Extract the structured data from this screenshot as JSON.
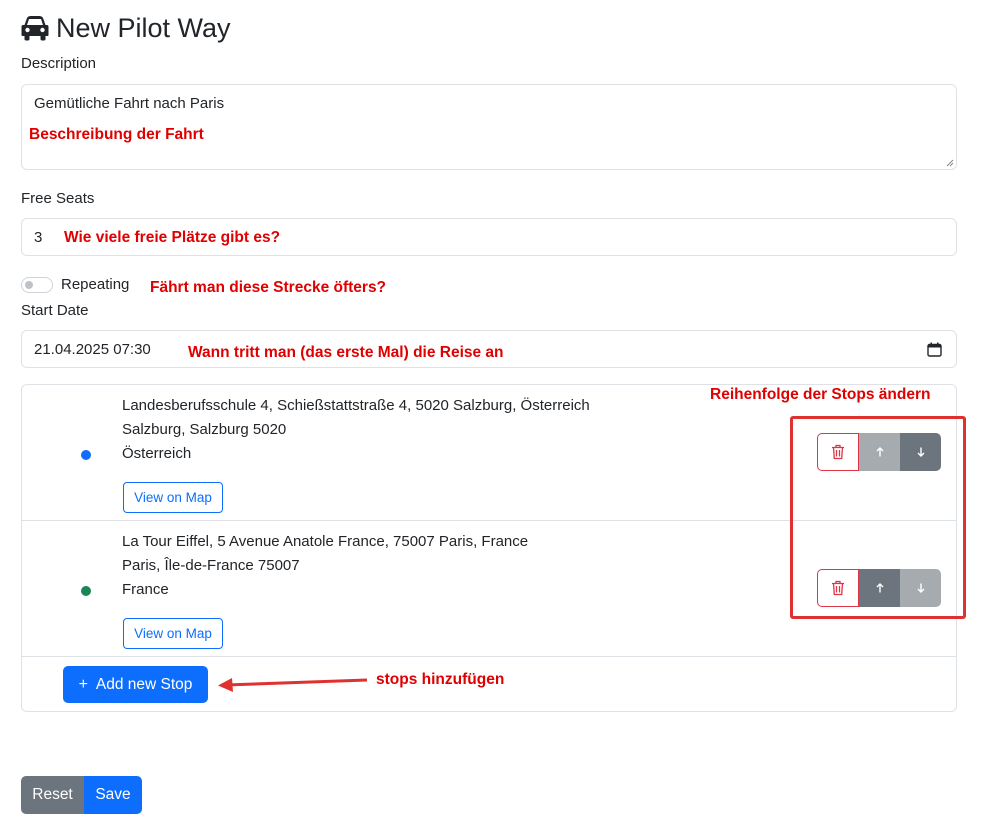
{
  "header": {
    "title": "New Pilot Way",
    "icon": "car-icon"
  },
  "form": {
    "description_label": "Description",
    "description_value": "Gemütliche Fahrt nach Paris",
    "free_seats_label": "Free Seats",
    "free_seats_value": "3",
    "repeating_label": "Repeating",
    "repeating_on": false,
    "start_date_label": "Start Date",
    "start_date_value": "21.04.2025 07:30"
  },
  "stops": [
    {
      "line1": "Landesberufsschule 4, Schießstattstraße 4, 5020 Salzburg, Österreich",
      "line2": "Salzburg, Salzburg 5020",
      "line3": "Österreich",
      "map_button": "View on Map",
      "dot_color": "#0d6efd"
    },
    {
      "line1": "La Tour Eiffel, 5 Avenue Anatole France, 75007 Paris, France",
      "line2": "Paris, Île-de-France 75007",
      "line3": "France",
      "map_button": "View on Map",
      "dot_color": "#198754"
    }
  ],
  "add_stop_label": "Add new Stop",
  "footer": {
    "reset_label": "Reset",
    "save_label": "Save"
  },
  "annotations": {
    "description": "Beschreibung der Fahrt",
    "seats": "Wie viele freie Plätze gibt es?",
    "repeating": "Fährt man diese Strecke öfters?",
    "date": "Wann tritt man (das erste Mal) die Reise an",
    "reorder": "Reihenfolge der Stops ändern",
    "add_stop": "stops hinzufügen"
  },
  "colors": {
    "primary": "#0d6efd",
    "secondary": "#6c757d",
    "danger": "#dc3545",
    "annotation_red": "#e00000"
  }
}
